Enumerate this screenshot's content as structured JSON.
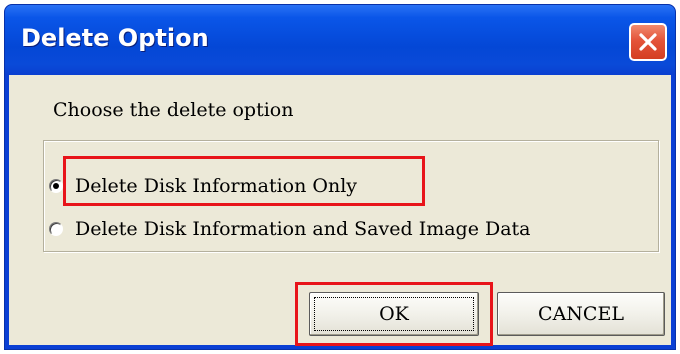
{
  "window": {
    "title": "Delete Option"
  },
  "dialog": {
    "prompt": "Choose the delete option",
    "options": [
      {
        "label": "Delete Disk Information Only",
        "selected": true
      },
      {
        "label": "Delete Disk Information and Saved Image Data",
        "selected": false
      }
    ]
  },
  "buttons": {
    "ok_label": "OK",
    "cancel_label": "CANCEL"
  },
  "colors": {
    "titlebar": "#0a56e8",
    "dialog_background": "#ece9d8",
    "close_button": "#e4543a",
    "highlight": "#e8141a"
  },
  "icons": {
    "close": "close-icon"
  }
}
